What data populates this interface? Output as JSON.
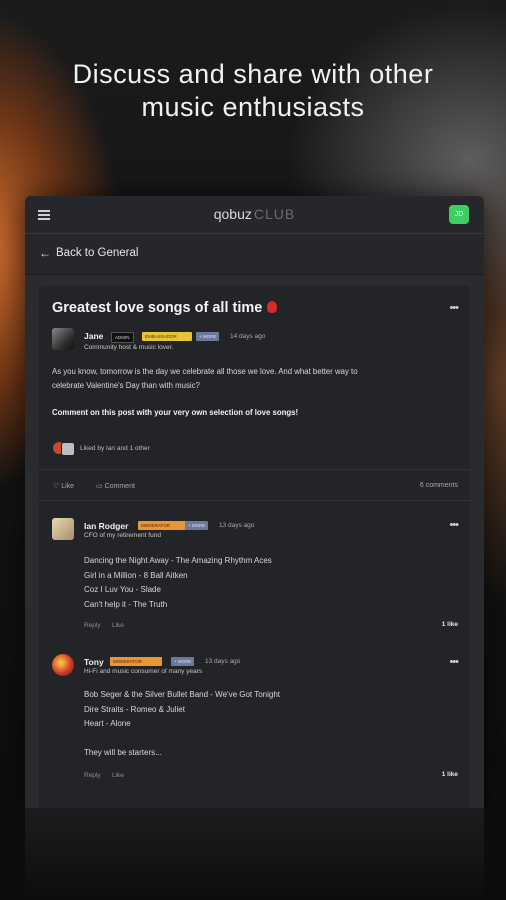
{
  "headline": [
    "Discuss and share with other",
    "music enthusiasts"
  ],
  "app": {
    "logo": "qobuz",
    "logo_suffix": "CLUB",
    "user_initials": "JD",
    "back_label": "Back to General"
  },
  "post": {
    "title": "Greatest love songs of all time",
    "author": "Jane",
    "badges": [
      "ADMIN",
      "EMBASSADOR",
      "+ MORE"
    ],
    "time": "14 days ago",
    "subtitle": "Community host & music lover.",
    "body_lines": [
      "As you know, tomorrow is the day we celebrate all those we love. And what better way to",
      "celebrate Valentine's Day than with music?"
    ],
    "body_bold": "Comment on this post with your very own selection of love songs!",
    "liked_by": "Liked by Ian and 1 other",
    "like_label": "Like",
    "comment_label": "Comment",
    "comments_count": "6 comments"
  },
  "comments": [
    {
      "author": "Ian Rodger",
      "badge": "MODERATOR",
      "more": "+ MORE",
      "time": "13 days ago",
      "subtitle": "CFO of my retirement fund",
      "lines": [
        "Dancing the Night Away - The Amazing Rhythm Aces",
        "Girl in a Million - 8 Ball Aitken",
        "Coz I Luv You - Slade",
        "Can't help it - The Truth"
      ],
      "reply": "Reply",
      "like": "Like",
      "likes": "1 like"
    },
    {
      "author": "Tony",
      "badge": "MODERATOR",
      "more": "+ MORE",
      "time": "13 days ago",
      "subtitle": "Hi-Fi and music consumer of many years",
      "lines": [
        "Bob Seger & the Silver Bullet Band - We've Got Tonight",
        "Dire Straits - Romeo & Juliet",
        "Heart - Alone",
        "",
        "They will be starters..."
      ],
      "reply": "Reply",
      "like": "Like",
      "likes": "1 like"
    }
  ],
  "colors": {
    "accent_green": "#3ecf62",
    "badge_yellow": "#e8c23a",
    "badge_orange": "#e9953a",
    "badge_blue": "#6b7a9a"
  }
}
